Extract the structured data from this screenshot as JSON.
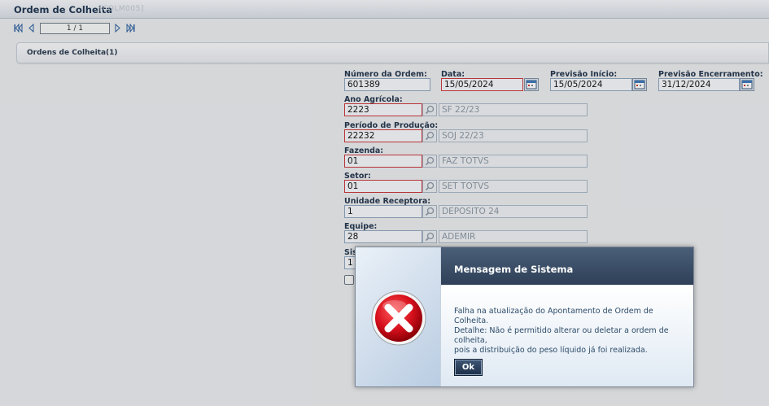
{
  "window": {
    "title": "Ordem de Colheita",
    "code": "[COLM005]"
  },
  "nav": {
    "page": "1 / 1"
  },
  "section": {
    "title": "Ordens de Colheita(1)"
  },
  "form": {
    "numero_ordem": {
      "label": "Número da Ordem:",
      "value": "601389"
    },
    "data": {
      "label": "Data:",
      "value": "15/05/2024"
    },
    "previsao_inicio": {
      "label": "Previsão Início:",
      "value": "15/05/2024"
    },
    "previsao_encerramento": {
      "label": "Previsão Encerramento:",
      "value": "31/12/2024"
    },
    "ano_agricola": {
      "label": "Ano Agrícola:",
      "value": "2223",
      "desc": "SF 22/23"
    },
    "periodo_producao": {
      "label": "Período de Produção:",
      "value": "22232",
      "desc": "SOJ 22/23"
    },
    "fazenda": {
      "label": "Fazenda:",
      "value": "01",
      "desc": "FAZ TOTVS"
    },
    "setor": {
      "label": "Setor:",
      "value": "01",
      "desc": "SET TOTVS"
    },
    "unidade_receptora": {
      "label": "Unidade Receptora:",
      "value": "1",
      "desc": "DEPOSITO 24"
    },
    "equipe": {
      "label": "Equipe:",
      "value": "28",
      "desc": "ADEMIR"
    },
    "sistema": {
      "label": "Sis",
      "value": "1"
    }
  },
  "dialog": {
    "title": "Mensagem de Sistema",
    "line1": "Falha na atualização do Apontamento de Ordem de Colheita.",
    "line2": "Detalhe: Não é permitido alterar ou deletar a ordem de colheita,",
    "line3": "pois a distribuição do peso líquido já foi realizada.",
    "ok_label": "Ok"
  },
  "colors": {
    "header": "#2f4058",
    "required_border": "#c9383b",
    "error": "#c8102e"
  }
}
